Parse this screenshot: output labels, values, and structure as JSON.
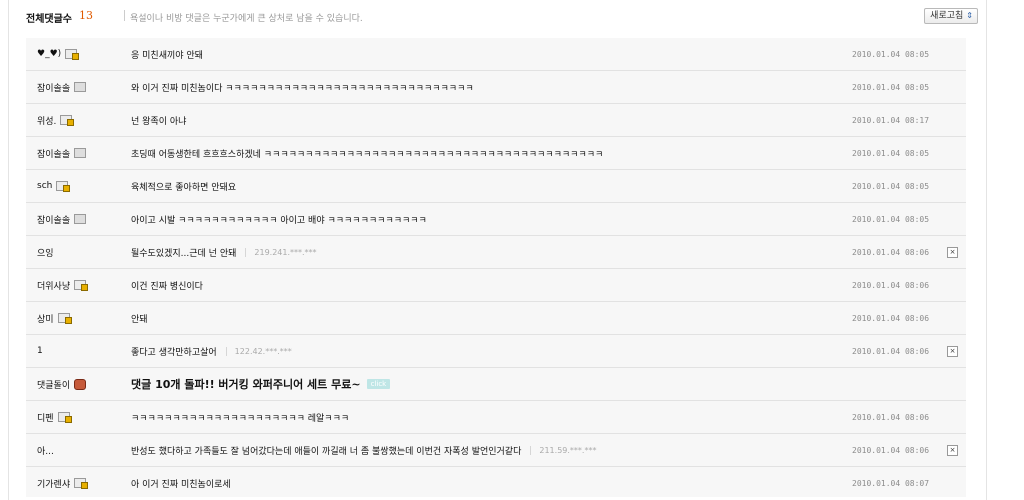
{
  "header": {
    "total_label": "전체댓글수",
    "total_count": "13",
    "notice": "욕설이나 비방 댓글은 누군가에게 큰 상처로 남을 수 있습니다.",
    "refresh_label": "새로고침"
  },
  "comments": [
    {
      "author": "♥_♥)",
      "icon": "lock",
      "content": "응 미친새끼야 안돼",
      "date": "2010.01.04 08:05"
    },
    {
      "author": "잠이솔솔",
      "icon": "plain",
      "content": "와 이거 진짜 미친놈이다 ㅋㅋㅋㅋㅋㅋㅋㅋㅋㅋㅋㅋㅋㅋㅋㅋㅋㅋㅋㅋㅋㅋㅋㅋㅋㅋㅋㅋㅋㅋ",
      "date": "2010.01.04 08:05"
    },
    {
      "author": "위성.",
      "icon": "lock",
      "content": "넌 왕족이 아냐",
      "date": "2010.01.04 08:17"
    },
    {
      "author": "잠이솔솔",
      "icon": "plain",
      "content": "초딩때 어동생한테 흐흐흐스하겠네 ㅋㅋㅋㅋㅋㅋㅋㅋㅋㅋㅋㅋㅋㅋㅋㅋㅋㅋㅋㅋㅋㅋㅋㅋㅋㅋㅋㅋㅋㅋㅋㅋㅋㅋㅋㅋㅋㅋㅋㅋㅋ",
      "date": "2010.01.04 08:05"
    },
    {
      "author": "sch",
      "icon": "lock",
      "content": "육체적으로 좋아하면 안돼요",
      "date": "2010.01.04 08:05"
    },
    {
      "author": "잠이솔솔",
      "icon": "plain",
      "content": "아이고 시발 ㅋㅋㅋㅋㅋㅋㅋㅋㅋㅋㅋㅋ 아이고 배야 ㅋㅋㅋㅋㅋㅋㅋㅋㅋㅋㅋㅋ",
      "date": "2010.01.04 08:05"
    },
    {
      "author": "으잉",
      "icon": "",
      "content": "될수도있겠지...근데 넌 안돼",
      "ip": "219.241.***.***",
      "date": "2010.01.04 08:06",
      "deletable": true
    },
    {
      "author": "더위사냥",
      "icon": "lock",
      "content": "이건 진짜 병신이다",
      "date": "2010.01.04 08:06"
    },
    {
      "author": "상미",
      "icon": "lock",
      "content": "안돼",
      "date": "2010.01.04 08:06"
    },
    {
      "author": "1",
      "icon": "",
      "content": "좋다고 생각만하고살어",
      "ip": "122.42.***.***",
      "date": "2010.01.04 08:06",
      "deletable": true
    },
    {
      "author": "댓글돌이",
      "icon": "sticker",
      "content": "댓글 10개 돌파!! 버거킹 와퍼주니어 세트 무료~",
      "tag": "click",
      "date": "",
      "big": true
    },
    {
      "author": "디펜",
      "icon": "lock",
      "content": "ㅋㅋㅋㅋㅋㅋㅋㅋㅋㅋㅋㅋㅋㅋㅋㅋㅋㅋㅋㅋㅋ 레알ㅋㅋㅋ",
      "date": "2010.01.04 08:06"
    },
    {
      "author": "아...",
      "icon": "",
      "content": "반성도 했다하고 가족들도 잘 넘어갔다는데 애들이 까길래 너 좀 불쌍했는데 이번건 자폭성 발언인거같다",
      "ip": "211.59.***.***",
      "date": "2010.01.04 08:06",
      "deletable": true
    },
    {
      "author": "기가렌샤",
      "icon": "lock",
      "content": "아 이거 진짜 미친놈이로세",
      "date": "2010.01.04 08:07"
    }
  ]
}
